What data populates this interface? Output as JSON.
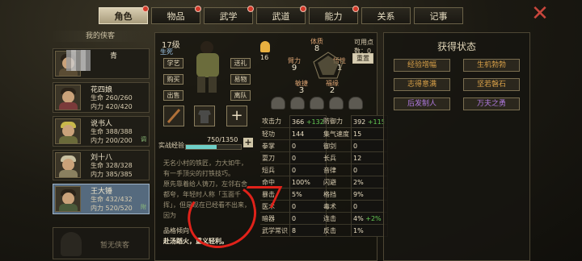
{
  "tabs": [
    {
      "label": "角色",
      "active": true
    },
    {
      "label": "物品",
      "active": false
    },
    {
      "label": "武学",
      "active": false
    },
    {
      "label": "武道",
      "active": false
    },
    {
      "label": "能力",
      "active": false
    },
    {
      "label": "关系",
      "active": false
    },
    {
      "label": "记事",
      "active": false
    }
  ],
  "roster": {
    "title": "我的侠客",
    "members": [
      {
        "name": "",
        "l1": "",
        "l2": "",
        "tag": ""
      },
      {
        "name": "花四娘",
        "l1": "生命 260/260",
        "l2": "内力 420/420",
        "tag": ""
      },
      {
        "name": "说书人",
        "l1": "生命 388/388",
        "l2": "内力 200/200",
        "tag": "调"
      },
      {
        "name": "刘十八",
        "l1": "生命 328/328",
        "l2": "内力 385/385",
        "tag": ""
      },
      {
        "name": "王大锤",
        "l1": "生命 432/432",
        "l2": "内力 520/520",
        "tag": "附"
      }
    ],
    "empty_label": "暂无侠客",
    "blur_letter": "青"
  },
  "hero": {
    "level": "17级",
    "sub": "生死",
    "point_value": "16",
    "buttons_left": [
      "学艺",
      "购买",
      "出售"
    ],
    "buttons_right": [
      "送礼",
      "易物",
      "离队"
    ],
    "xp_label": "实战经验",
    "xp_value": "750/1350",
    "xp_fraction": 0.5556,
    "desc": "无名小村的铁匠，力大如牛，有一手顶尖的打铁技巧。\n原先靠着给人铸刀，左邻右舍都夸，年轻时人称「玉面千挥」，但是现在已经看不出来，因为",
    "trait_label": "品格倾向",
    "trait": "赴汤蹈火，重义轻利。"
  },
  "attributes": {
    "available_label": "可用点数：",
    "available": "0",
    "reset": "重置",
    "tizhi": {
      "label": "体质",
      "value": "8"
    },
    "biili": {
      "label": "臂力",
      "value": "9"
    },
    "wuxing": {
      "label": "悟性",
      "value": "1"
    },
    "minjie": {
      "label": "敏捷",
      "value": "3"
    },
    "fuyuan": {
      "label": "福缘",
      "value": "2"
    }
  },
  "stats_left": [
    {
      "k": "攻击力",
      "v": "366",
      "b": "+132"
    },
    {
      "k": "轻功",
      "v": "144",
      "b": ""
    },
    {
      "k": "拳掌",
      "v": "0",
      "b": ""
    },
    {
      "k": "耍刀",
      "v": "0",
      "b": ""
    },
    {
      "k": "短兵",
      "v": "0",
      "b": ""
    },
    {
      "k": "命中",
      "v": "100%",
      "b": ""
    },
    {
      "k": "暴击",
      "v": "5%",
      "b": ""
    },
    {
      "k": "医术",
      "v": "0",
      "b": ""
    },
    {
      "k": "暗器",
      "v": "0",
      "b": ""
    },
    {
      "k": "武学常识",
      "v": "8",
      "b": ""
    }
  ],
  "stats_right": [
    {
      "k": "防御力",
      "v": "392",
      "b": "+115"
    },
    {
      "k": "集气速度",
      "v": "15",
      "b": ""
    },
    {
      "k": "御剑",
      "v": "0",
      "b": ""
    },
    {
      "k": "长兵",
      "v": "12",
      "b": ""
    },
    {
      "k": "音律",
      "v": "0",
      "b": ""
    },
    {
      "k": "闪避",
      "v": "2%",
      "b": ""
    },
    {
      "k": "格挡",
      "v": "9%",
      "b": ""
    },
    {
      "k": "毒术",
      "v": "0",
      "b": ""
    },
    {
      "k": "连击",
      "v": "4%",
      "b": "+2%"
    },
    {
      "k": "反击",
      "v": "1%",
      "b": ""
    }
  ],
  "status": {
    "title": "获得状态",
    "items": [
      {
        "label": "经验增幅",
        "color": "gold"
      },
      {
        "label": "生机勃勃",
        "color": "gold"
      },
      {
        "label": "志得意满",
        "color": "gold"
      },
      {
        "label": "坚若磐石",
        "color": "gold"
      },
      {
        "label": "后发制人",
        "color": "purple"
      },
      {
        "label": "万夫之勇",
        "color": "purple"
      }
    ]
  },
  "colors": {
    "gold": "#d8a048",
    "purple": "#b07ae0",
    "mark": "#e0221a"
  }
}
